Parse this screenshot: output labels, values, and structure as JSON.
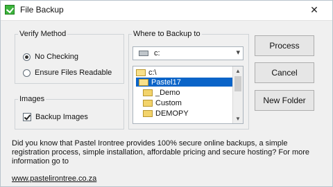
{
  "window": {
    "title": "File Backup",
    "close_symbol": "✕"
  },
  "verify_method": {
    "legend": "Verify Method",
    "options": [
      {
        "label": "No Checking",
        "selected": true
      },
      {
        "label": "Ensure Files Readable",
        "selected": false
      }
    ]
  },
  "images": {
    "legend": "Images",
    "backup_images_label": "Backup Images",
    "backup_images_checked": true
  },
  "backup_target": {
    "legend": "Where to Backup to",
    "drive": "c:",
    "folders": [
      {
        "label": "c:\\",
        "type": "open"
      },
      {
        "label": "Pastel17",
        "type": "open",
        "selected": true
      },
      {
        "label": "_Demo",
        "type": "closed"
      },
      {
        "label": "Custom",
        "type": "closed"
      },
      {
        "label": "DEMOPY",
        "type": "closed"
      }
    ]
  },
  "buttons": {
    "process": "Process",
    "cancel": "Cancel",
    "new_folder": "New Folder"
  },
  "info": {
    "text": "Did you know that Pastel Irontree provides 100% secure online backups, a simple registration process, simple installation, affordable pricing and secure hosting? For more information go to",
    "link": "www.pastelirontree.co.za"
  },
  "colors": {
    "selection": "#0a64c8",
    "folder": "#f2d36b",
    "check_icon_green": "#3cb43c"
  }
}
